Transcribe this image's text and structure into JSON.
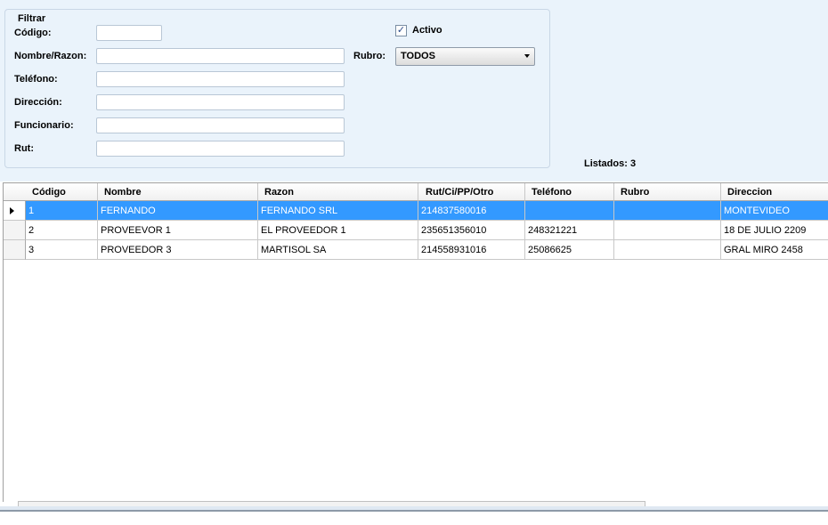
{
  "filter": {
    "title": "Filtrar",
    "codigo_label": "Código:",
    "codigo_value": "",
    "nombre_label": "Nombre/Razon:",
    "nombre_value": "",
    "telefono_label": "Teléfono:",
    "telefono_value": "",
    "direccion_label": "Dirección:",
    "direccion_value": "",
    "funcionario_label": "Funcionario:",
    "funcionario_value": "",
    "rut_label": "Rut:",
    "rut_value": "",
    "activo_label": "Activo",
    "activo_checked": true,
    "rubro_label": "Rubro:",
    "rubro_value": "TODOS"
  },
  "listados": "Listados: 3",
  "grid": {
    "columns": [
      "Código",
      "Nombre",
      "Razon",
      "Rut/Ci/PP/Otro",
      "Teléfono",
      "Rubro",
      "Direccion"
    ],
    "rows": [
      [
        "1",
        "FERNANDO",
        "FERNANDO SRL",
        "214837580016",
        "",
        "",
        "MONTEVIDEO"
      ],
      [
        "2",
        "PROVEEVOR 1",
        "EL PROVEEDOR 1",
        "235651356010",
        "248321221",
        "",
        "18 DE JULIO 2209"
      ],
      [
        "3",
        "PROVEEDOR 3",
        "MARTISOL SA",
        "214558931016",
        "25086625",
        "",
        "GRAL MIRO 2458"
      ]
    ],
    "selected_row": 0
  },
  "colors": {
    "selection": "#3399ff",
    "form_bg": "#eaf3fb"
  },
  "icons": {
    "row_pointer": "triangle-right-icon",
    "dropdown": "chevron-down-icon",
    "checkbox": "checkmark-icon"
  }
}
